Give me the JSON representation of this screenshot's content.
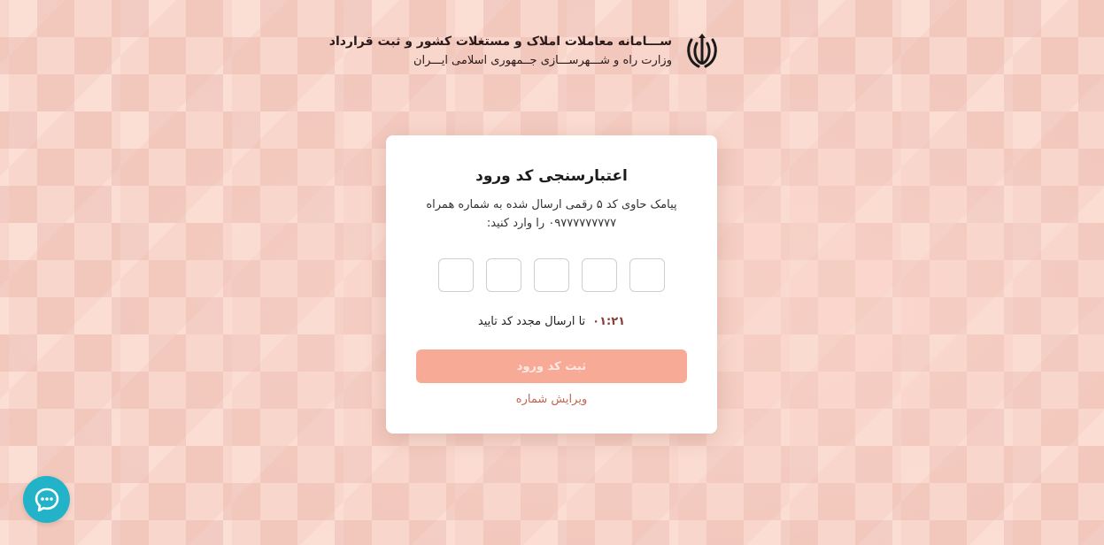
{
  "header": {
    "title": "ســـامانه معاملات املاک و مستغلات کشور و ثبت قرارداد",
    "subtitle": "وزارت راه و شـــهرســـازی جــمهوری اسلامی ایـــران",
    "emblem_icon": "iran-emblem-icon"
  },
  "card": {
    "title": "اعتبارسنجی کد ورود",
    "description_line1": "پیامک حاوی کد ۵ رقمی ارسال شده به شماره همراه",
    "description_line2": "۰۹۷۷۷۷۷۷۷۷۷ را وارد کنید:",
    "otp_digits": [
      "",
      "",
      "",
      "",
      ""
    ],
    "timer": "۰۱:۲۱",
    "timer_label": "تا ارسال مجدد کد تایید",
    "submit_label": "ثبت کد ورود",
    "edit_label": "ویرایش شماره"
  },
  "chat": {
    "icon": "chat-bubble-icon"
  },
  "colors": {
    "accent": "#f7ab96",
    "link": "#c4644f",
    "timer": "#8a3d35",
    "chat": "#22b3c9"
  }
}
